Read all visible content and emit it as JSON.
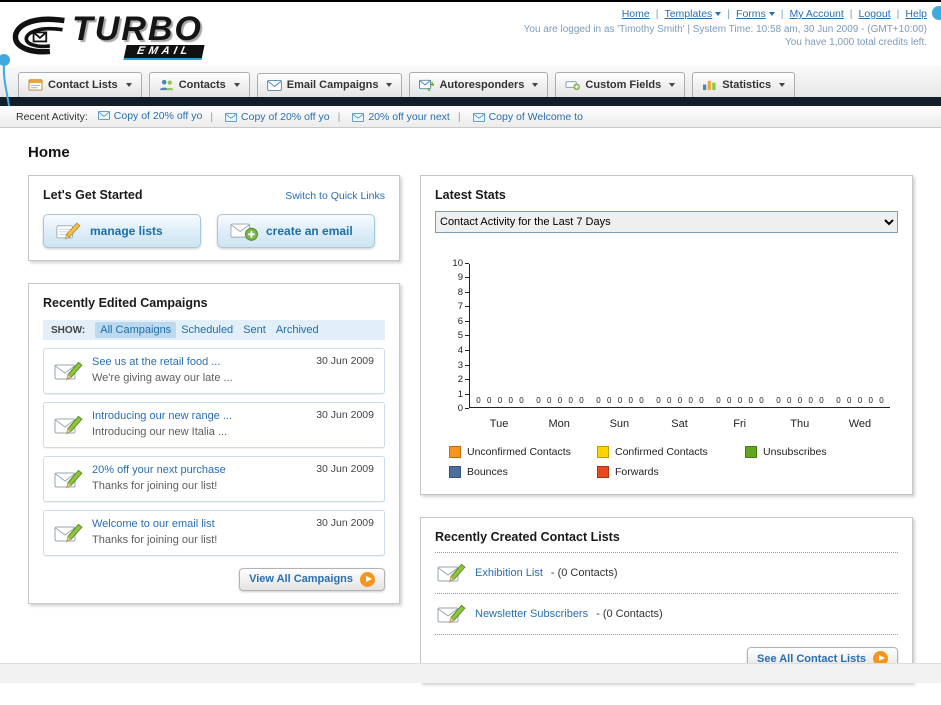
{
  "page": {
    "title": "Home"
  },
  "header": {
    "logo": {
      "main": "TURBO",
      "sub": "EMAIL"
    },
    "links": [
      {
        "label": "Home",
        "has_menu": false
      },
      {
        "label": "Templates",
        "has_menu": true
      },
      {
        "label": "Forms",
        "has_menu": true
      },
      {
        "label": "My Account",
        "has_menu": false
      },
      {
        "label": "Logout",
        "has_menu": false
      },
      {
        "label": "Help",
        "has_menu": false
      }
    ],
    "login_info": "You are logged in as 'Timothy Smith' | System Time: 10:58 am, 30 Jun 2009 - (GMT+10:00)",
    "credits_info": "You have 1,000 total credits left."
  },
  "nav": {
    "tabs": [
      {
        "label": "Contact Lists",
        "icon": "contact-lists-icon"
      },
      {
        "label": "Contacts",
        "icon": "contacts-icon"
      },
      {
        "label": "Email Campaigns",
        "icon": "email-campaigns-icon"
      },
      {
        "label": "Autoresponders",
        "icon": "autoresponders-icon"
      },
      {
        "label": "Custom Fields",
        "icon": "custom-fields-icon"
      },
      {
        "label": "Statistics",
        "icon": "statistics-icon"
      }
    ]
  },
  "activity": {
    "label": "Recent Activity:",
    "items": [
      "Copy of 20% off yo",
      "Copy of 20% off yo",
      "20% off your next",
      "Copy of Welcome to"
    ]
  },
  "get_started": {
    "title": "Let's Get Started",
    "switch_link": "Switch to Quick Links",
    "buttons": [
      {
        "label": "manage lists",
        "icon": "pencil-icon"
      },
      {
        "label": "create an email",
        "icon": "envelope-plus-icon"
      }
    ]
  },
  "campaigns": {
    "title": "Recently Edited Campaigns",
    "show_label": "SHOW:",
    "filters": [
      {
        "label": "All Campaigns",
        "selected": true
      },
      {
        "label": "Scheduled",
        "selected": false
      },
      {
        "label": "Sent",
        "selected": false
      },
      {
        "label": "Archived",
        "selected": false
      }
    ],
    "items": [
      {
        "title": "See us at the retail food ...",
        "subtitle": "We're giving away our late ...",
        "date": "30 Jun 2009"
      },
      {
        "title": "Introducing our new range ...",
        "subtitle": "Introducing our new Italia ...",
        "date": "30 Jun 2009"
      },
      {
        "title": "20% off your next purchase",
        "subtitle": "Thanks for joining our list!",
        "date": "30 Jun 2009"
      },
      {
        "title": "Welcome to our email list",
        "subtitle": "Thanks for joining our list!",
        "date": "30 Jun 2009"
      }
    ],
    "view_all_label": "View All Campaigns"
  },
  "stats": {
    "title": "Latest Stats",
    "selected_option": "Contact Activity for the Last 7 Days",
    "chart_data": {
      "type": "bar",
      "categories": [
        "Tue",
        "Mon",
        "Sun",
        "Sat",
        "Fri",
        "Thu",
        "Wed"
      ],
      "series": [
        {
          "name": "Unconfirmed Contacts",
          "values": [
            0,
            0,
            0,
            0,
            0,
            0,
            0
          ]
        },
        {
          "name": "Confirmed Contacts",
          "values": [
            0,
            0,
            0,
            0,
            0,
            0,
            0
          ]
        },
        {
          "name": "Unsubscribes",
          "values": [
            0,
            0,
            0,
            0,
            0,
            0,
            0
          ]
        },
        {
          "name": "Bounces",
          "values": [
            0,
            0,
            0,
            0,
            0,
            0,
            0
          ]
        },
        {
          "name": "Forwards",
          "values": [
            0,
            0,
            0,
            0,
            0,
            0,
            0
          ]
        }
      ],
      "ylim": [
        0,
        10
      ],
      "ytick_step": 1,
      "grid": false,
      "legend_position": "bottom"
    },
    "legend": [
      {
        "label": "Unconfirmed Contacts",
        "color": "#f7941d"
      },
      {
        "label": "Confirmed Contacts",
        "color": "#fdd400"
      },
      {
        "label": "Unsubscribes",
        "color": "#61a521"
      },
      {
        "label": "Bounces",
        "color": "#4b6e9e"
      },
      {
        "label": "Forwards",
        "color": "#e8491d"
      }
    ]
  },
  "contact_lists": {
    "title": "Recently Created Contact Lists",
    "items": [
      {
        "name": "Exhibition List",
        "detail": "- (0 Contacts)"
      },
      {
        "name": "Newsletter Subscribers",
        "detail": "- (0 Contacts)"
      }
    ],
    "see_all_label": "See All Contact Lists"
  }
}
